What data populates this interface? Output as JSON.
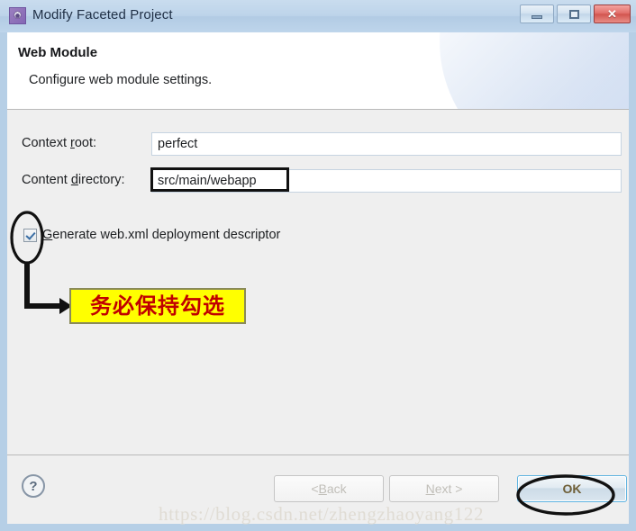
{
  "window": {
    "title": "Modify Faceted Project",
    "icon": "gear-icon",
    "controls": {
      "minimize": "–",
      "maximize": "□",
      "close": "✕"
    }
  },
  "header": {
    "title": "Web Module",
    "description": "Configure web module settings."
  },
  "form": {
    "context_root": {
      "label_pre": "Context ",
      "label_mnemonic": "r",
      "label_post": "oot:",
      "value": "perfect"
    },
    "content_directory": {
      "label_pre": "Content ",
      "label_mnemonic": "d",
      "label_post": "irectory:",
      "value": "src/main/webapp"
    },
    "generate_webxml": {
      "label_pre": "",
      "label_mnemonic": "G",
      "label_post": "enerate web.xml deployment descriptor",
      "checked": true
    }
  },
  "annotations": {
    "callout_text": "务必保持勾选",
    "callout_bg": "#ffff00",
    "callout_color": "#c00000",
    "ellipse_color": "#111111"
  },
  "footer": {
    "help": "?",
    "back": {
      "pre": "< ",
      "mnemonic": "B",
      "post": "ack"
    },
    "next": {
      "pre": "",
      "mnemonic": "N",
      "post": "ext >"
    },
    "ok": "OK"
  },
  "watermark": "https://blog.csdn.net/zhengzhaoyang122"
}
